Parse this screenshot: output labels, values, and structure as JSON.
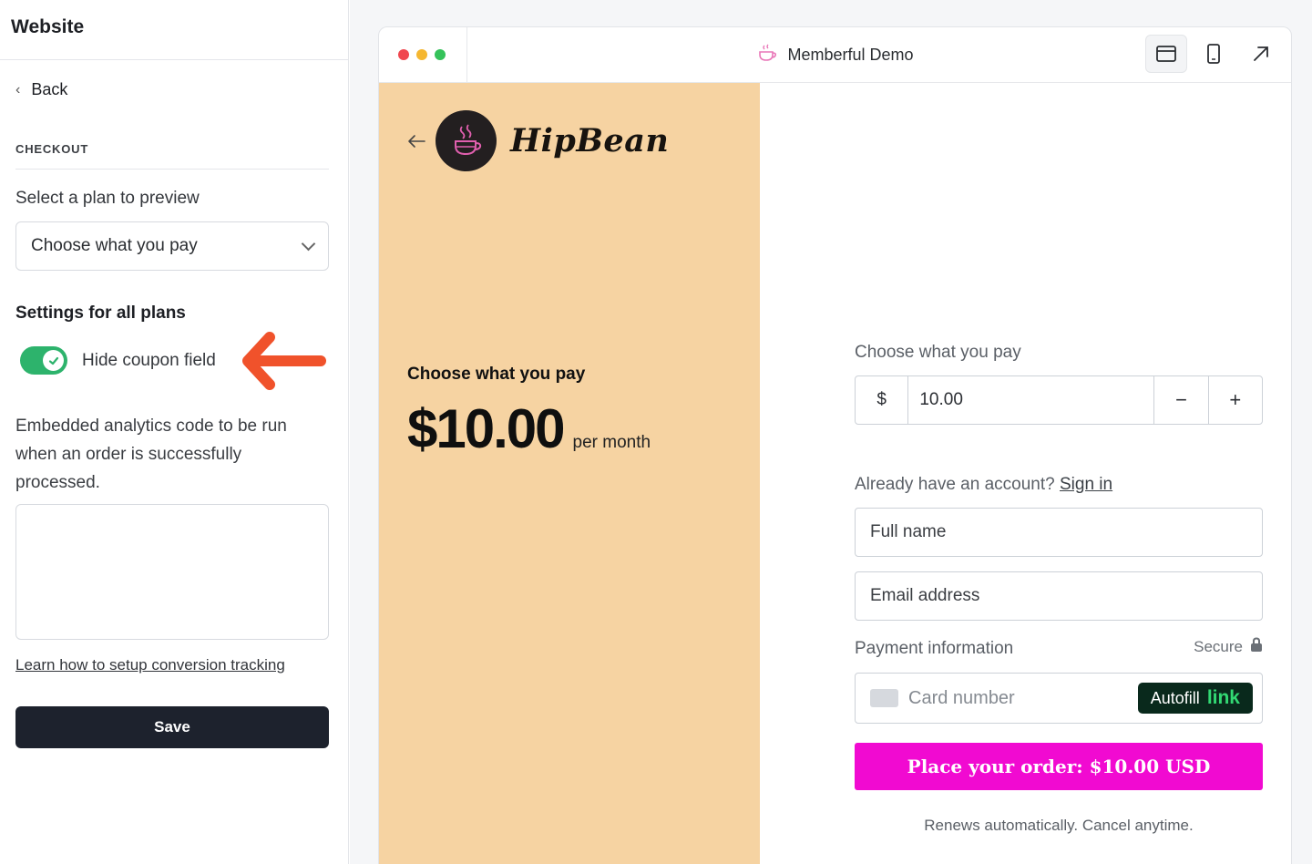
{
  "sidebar": {
    "title": "Website",
    "back_label": "Back",
    "section_label": "CHECKOUT",
    "plan_select_label": "Select a plan to preview",
    "plan_select_value": "Choose what you pay",
    "settings_heading": "Settings for all plans",
    "toggle_label": "Hide coupon field",
    "toggle_on": true,
    "analytics_label": "Embedded analytics code to be run when an order is successfully processed.",
    "analytics_value": "",
    "learn_link": "Learn how to setup conversion tracking",
    "save_label": "Save"
  },
  "browser": {
    "title": "Memberful Demo",
    "icons": [
      "desktop-view-icon",
      "mobile-view-icon",
      "open-external-icon"
    ]
  },
  "checkout": {
    "brand": "HipBean",
    "plan_name": "Choose what you pay",
    "price": "$10.00",
    "period": "per month",
    "pay_label": "Choose what you pay",
    "currency_symbol": "$",
    "amount": "10.00",
    "minus": "−",
    "plus": "+",
    "account_prompt": "Already have an account?",
    "sign_in": "Sign in",
    "full_name_placeholder": "Full name",
    "email_placeholder": "Email address",
    "payment_label": "Payment information",
    "secure_label": "Secure",
    "card_placeholder": "Card number",
    "autofill_label": "Autofill",
    "autofill_link": "link",
    "order_button": "Place your order: $10.00 USD",
    "renews_note": "Renews automatically. Cancel anytime."
  },
  "colors": {
    "accent_green": "#2db36c",
    "arrow_orange": "#f0522b",
    "preview_panel": "#f6d3a2",
    "order_button": "#f10ad1",
    "save_button": "#1d222d"
  }
}
